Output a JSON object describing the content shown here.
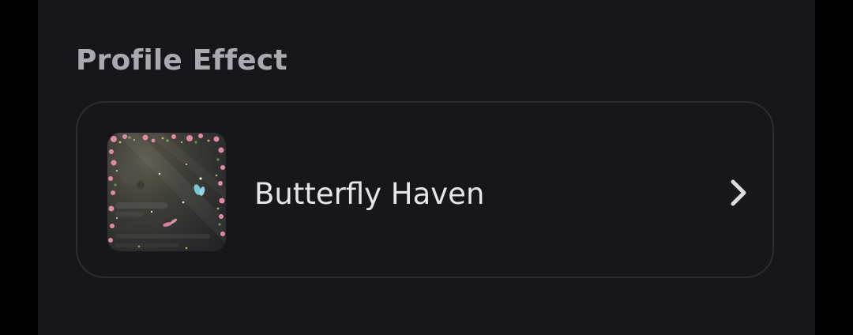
{
  "section": {
    "title": "Profile Effect"
  },
  "effect": {
    "name": "Butterfly Haven",
    "thumbnail_icon": "butterfly-haven-preview",
    "action_icon": "chevron-right-icon"
  },
  "colors": {
    "panel_background": "#17171b",
    "title_text": "#a8a9b1",
    "item_text": "#e6e6ea",
    "border": "#2c2d33",
    "flower_pink": "#e08aa6",
    "butterfly_blue": "#7fd6e6"
  }
}
